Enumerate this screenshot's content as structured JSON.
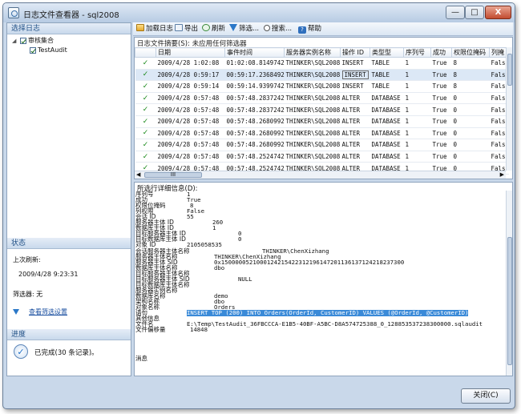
{
  "window": {
    "title": "日志文件查看器 - sql2008"
  },
  "title_controls": {
    "minimize": "—",
    "maximize": "□",
    "close": "X"
  },
  "select_log": {
    "header": "选择日志",
    "tree": [
      {
        "label": "审核集合",
        "toggle": "◢"
      },
      {
        "label": "TestAudit"
      }
    ]
  },
  "status": {
    "header": "状态",
    "last_refresh_label": "上次刷新:",
    "last_refresh_value": "2009/4/28 9:23:31",
    "filter_label": "筛选器: 无",
    "view_filter_link": "查看筛选设置"
  },
  "progress": {
    "header": "进度",
    "icon_glyph": "✓",
    "text": "已完成(30 条记录)。"
  },
  "toolbar": {
    "load_log": "加载日志",
    "export": "导出",
    "refresh": "刷新",
    "filter": "筛选...",
    "search": "搜索...",
    "help": "帮助",
    "help_glyph": "?"
  },
  "summary": {
    "label": "日志文件摘要(S): 未应用任何筛选器",
    "columns": [
      "",
      "日期",
      "事件时间",
      "服务器实例名称",
      "操作 ID",
      "类型型",
      "序列号",
      "成功",
      "权限位掩码",
      "列掩"
    ],
    "rows": [
      [
        "✓",
        "2009/4/28 1:02:08",
        "01:02:08.8149742",
        "THINKER\\SQL2008",
        "INSERT",
        "TABLE",
        "1",
        "True",
        "8",
        "Fals"
      ],
      [
        "✓",
        "2009/4/28 0:59:17",
        "00:59:17.2368492",
        "THINKER\\SQL2008",
        "INSERT",
        "TABLE",
        "1",
        "True",
        "8",
        "Fals"
      ],
      [
        "✓",
        "2009/4/28 0:59:14",
        "00:59:14.9399742",
        "THINKER\\SQL2008",
        "INSERT",
        "TABLE",
        "1",
        "True",
        "8",
        "Fals"
      ],
      [
        "✓",
        "2009/4/28 0:57:48",
        "00:57:48.2837242",
        "THINKER\\SQL2008",
        "ALTER",
        "DATABASE",
        "1",
        "True",
        "0",
        "Fals"
      ],
      [
        "✓",
        "2009/4/28 0:57:48",
        "00:57:48.2837242",
        "THINKER\\SQL2008",
        "ALTER",
        "DATABASE",
        "1",
        "True",
        "0",
        "Fals"
      ],
      [
        "✓",
        "2009/4/28 0:57:48",
        "00:57:48.2680992",
        "THINKER\\SQL2008",
        "ALTER",
        "DATABASE",
        "1",
        "True",
        "0",
        "Fals"
      ],
      [
        "✓",
        "2009/4/28 0:57:48",
        "00:57:48.2680992",
        "THINKER\\SQL2008",
        "ALTER",
        "DATABASE",
        "1",
        "True",
        "0",
        "Fals"
      ],
      [
        "✓",
        "2009/4/28 0:57:48",
        "00:57:48.2680992",
        "THINKER\\SQL2008",
        "ALTER",
        "DATABASE",
        "1",
        "True",
        "0",
        "Fals"
      ],
      [
        "✓",
        "2009/4/28 0:57:48",
        "00:57:48.2524742",
        "THINKER\\SQL2008",
        "ALTER",
        "DATABASE",
        "1",
        "True",
        "0",
        "Fals"
      ],
      [
        "✓",
        "2009/4/28 0:57:48",
        "00:57:48.2524742",
        "THINKER\\SQL2008",
        "ALTER",
        "DATABASE",
        "1",
        "True",
        "0",
        "Fals"
      ]
    ],
    "hscroll_thumb": "III",
    "hscroll_left": "◀",
    "hscroll_right": "▶"
  },
  "details": {
    "label": "所选行详细信息(D):",
    "fields": [
      {
        "k": "序列号",
        "v": "1"
      },
      {
        "k": "成功",
        "v": "True"
      },
      {
        "k": "权限位掩码",
        "v": "8"
      },
      {
        "k": "列权限",
        "v": "False"
      },
      {
        "k": "会话 ID",
        "v": "55"
      },
      {
        "k": "服务器主体 ID",
        "v": "260"
      },
      {
        "k": "数据库主体 ID",
        "v": "1"
      },
      {
        "k": "目标服务器主体 ID",
        "v": "0"
      },
      {
        "k": "目标数据库主体 ID",
        "v": "0"
      },
      {
        "k": "对象 ID",
        "v": "2105058535"
      },
      {
        "k": "会话服务器主体名称",
        "v": "THINKER\\ChenXizhang"
      },
      {
        "k": "服务器主体名称",
        "v": "THINKER\\ChenXizhang"
      },
      {
        "k": "服务器主体 SID",
        "v": "0x1500000521000124215422312196147201136137124218237300"
      },
      {
        "k": "数据库主体名称",
        "v": "dbo"
      },
      {
        "k": "目标服务器主体名称",
        "v": ""
      },
      {
        "k": "目标服务器主体 SID",
        "v": "NULL"
      },
      {
        "k": "目标数据库主体名称",
        "v": ""
      },
      {
        "k": "服务器实例名称",
        "v": ""
      },
      {
        "k": "数据库名称",
        "v": "demo"
      },
      {
        "k": "架构名称",
        "v": "dbo"
      },
      {
        "k": "对象名称",
        "v": "Orders"
      },
      {
        "k": "语句",
        "v": "INSERT TOP (200) INTO Orders(OrderId, CustomerID) VALUES (@OrderId, @CustomerID)"
      },
      {
        "k": "其他信息",
        "v": ""
      },
      {
        "k": "文件名",
        "v": "E:\\Temp\\TestAudit_36FBCCCA-E1B5-40BF-A5BC-D8A574725388_0_128853537238300000.sqlaudit"
      },
      {
        "k": "文件偏移量",
        "v": "14848"
      }
    ],
    "message_label": "消息"
  },
  "footer": {
    "close_button": "关闭(C)"
  },
  "colors": {
    "accent": "#1f4f85",
    "selection": "#3a8ad8",
    "success": "#1c8a1c"
  }
}
